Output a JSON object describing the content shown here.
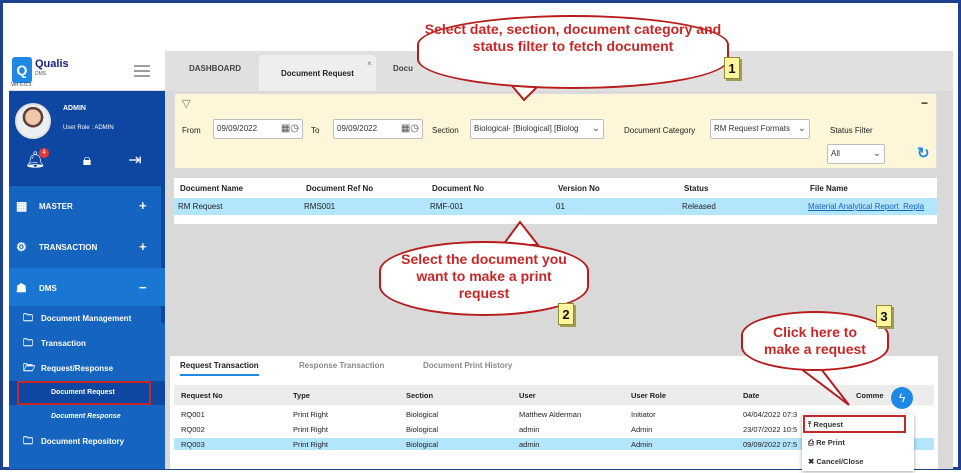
{
  "app": {
    "name": "Qualis",
    "sub": "DMS",
    "version": "Ver 6.0.3"
  },
  "user": {
    "name": "ADMIN",
    "role": "User Role : ADMIN",
    "notifications": "4"
  },
  "sidebar": {
    "items": [
      {
        "label": "MASTER",
        "toggle": "+"
      },
      {
        "label": "TRANSACTION",
        "toggle": "+"
      },
      {
        "label": "DMS",
        "toggle": "−"
      }
    ],
    "dms_children": [
      {
        "label": "Document Management"
      },
      {
        "label": "Transaction"
      },
      {
        "label": "Request/Response"
      }
    ],
    "request_children": [
      {
        "label": "Document Request"
      },
      {
        "label": "Document Response"
      }
    ],
    "last": {
      "label": "Document Repository"
    }
  },
  "tabs": [
    {
      "label": "DASHBOARD"
    },
    {
      "label": "Document Request"
    },
    {
      "label": "Docu"
    }
  ],
  "filter": {
    "from_label": "From",
    "from_value": "09/09/2022",
    "to_label": "To",
    "to_value": "09/09/2022",
    "section_label": "Section",
    "section_value": "Biological- [Biological]  [Biolog",
    "category_label": "Document Category",
    "category_value": "RM Request Formats",
    "status_label": "Status Filter",
    "status_value": "All"
  },
  "doc_table": {
    "headers": [
      "Document Name",
      "Document Ref No",
      "Document No",
      "Version No",
      "Status",
      "File Name"
    ],
    "row": [
      "RM Request",
      "RMS001",
      "RMF-001",
      "01",
      "Released",
      "Material Analytical Report_Repla"
    ]
  },
  "bottom_tabs": [
    "Request Transaction",
    "Response Transaction",
    "Document Print History"
  ],
  "request_table": {
    "headers": [
      "Request No",
      "Type",
      "Section",
      "User",
      "User Role",
      "Date",
      "Comme"
    ],
    "rows": [
      [
        "RQ001",
        "Print Right",
        "Biological",
        "Matthew Alderman",
        "Initiator",
        "04/04/2022 07:3"
      ],
      [
        "RQ002",
        "Print Right",
        "Biological",
        "admin",
        "Admin",
        "23/07/2022 10:5"
      ],
      [
        "RQ003",
        "Print Right",
        "Biological",
        "admin",
        "Admin",
        "09/09/2022 07:5"
      ]
    ]
  },
  "popup": {
    "request": "Request",
    "reprint": "Re Print",
    "cancel": "Cancel/Close"
  },
  "callouts": {
    "c1": "Select date, section, document category and status filter to fetch document",
    "c1_num": "1",
    "c2": "Select the document you want to make a print request",
    "c2_num": "2",
    "c3": "Click here to make a request",
    "c3_num": "3"
  },
  "colors": {
    "sidebar": "#1565c0",
    "filter_bg": "#fdf6d8",
    "selected_row": "#b3e5fc",
    "callout_border": "#b71c1c",
    "callout_text": "#c62828"
  }
}
